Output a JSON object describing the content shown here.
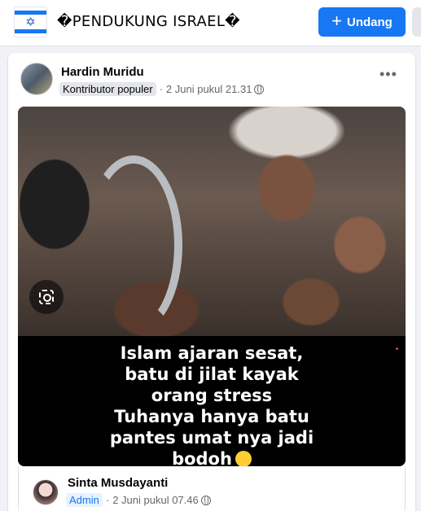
{
  "header": {
    "group_name": "�PENDUKUNG ISRAEL�",
    "invite_label": "Undang",
    "invite_icon": "plus-icon",
    "flag_icon": "israel-flag-icon",
    "flag_symbol": "✡"
  },
  "post": {
    "author": "Hardin Muridu",
    "author_badge": "Kontributor populer",
    "separator": "·",
    "timestamp": "2 Juni pukul 21.31",
    "privacy_icon": "globe-icon",
    "more_label": "•••",
    "caption_lines": [
      "Islam ajaran sesat,",
      "batu di jilat kayak",
      "orang stress",
      "Tuhanya hanya batu",
      "pantes umat nya jadi",
      "bodoh"
    ],
    "caption_emoji": "laughing-crying-emoji",
    "lens_icon": "visual-search-icon"
  },
  "next_post": {
    "author": "Sinta Musdayanti",
    "badge": "Admin",
    "separator": "·",
    "timestamp": "2 Juni pukul 07.46",
    "privacy_icon": "globe-icon"
  },
  "colors": {
    "accent": "#1877f2",
    "page_bg": "#f0f2f5",
    "card_bg": "#ffffff",
    "secondary_text": "#65676b"
  }
}
